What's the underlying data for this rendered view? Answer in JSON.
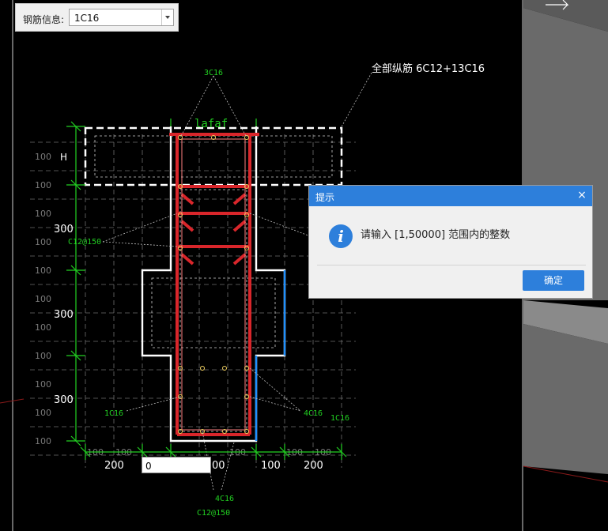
{
  "toolbar": {
    "label": "钢筋信息:",
    "value": "1C16"
  },
  "annotations": {
    "all_longitudinal": "全部纵筋 6C12+13C16",
    "top_bars": "3C16",
    "stirrups_left": "C12@150",
    "stirrups_bottom": "C12@150",
    "bottom_left_bar": "1C16",
    "bottom_right_bar_a": "4C16",
    "bottom_right_bar_b": "1C16",
    "bottom_bars": "4C16",
    "la_label": "lafaf",
    "h_label": "H"
  },
  "dimensions": {
    "grid_100": "100",
    "dim_300": "300",
    "dim_200": "200",
    "dim_100": "100",
    "dim_00": "00"
  },
  "dialog": {
    "title": "提示",
    "close": "×",
    "info_glyph": "i",
    "message": "请输入 [1,50000] 范围内的整数",
    "ok": "确定"
  },
  "input": {
    "value": "0"
  },
  "colors": {
    "background": "#000000",
    "rebar": "#d9262b",
    "outline": "#ffffff",
    "dim_line": "#22d022",
    "grid": "#6e6e6e",
    "accent": "#2d7fdb",
    "side_edge": "#1e90ff"
  }
}
